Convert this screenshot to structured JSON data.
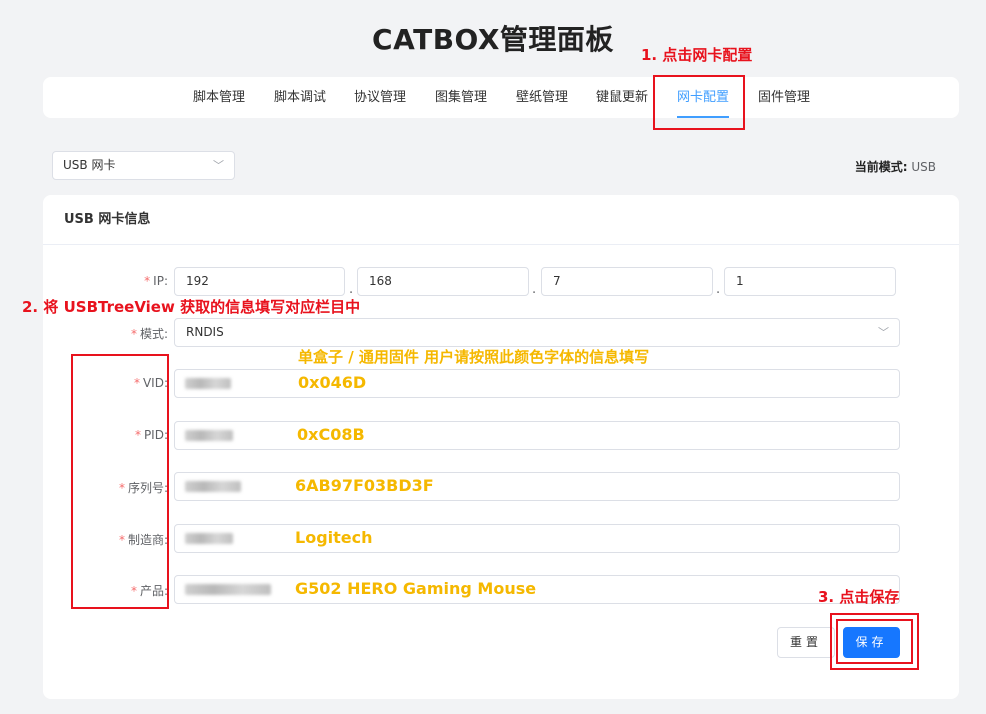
{
  "page": {
    "title": "CATBOX管理面板"
  },
  "nav": {
    "items": [
      {
        "label": "脚本管理"
      },
      {
        "label": "脚本调试"
      },
      {
        "label": "协议管理"
      },
      {
        "label": "图集管理"
      },
      {
        "label": "壁纸管理"
      },
      {
        "label": "键鼠更新"
      },
      {
        "label": "网卡配置",
        "active": true
      },
      {
        "label": "固件管理"
      }
    ]
  },
  "device_select": {
    "value": "USB 网卡"
  },
  "mode_status": {
    "label": "当前模式:",
    "value": "USB"
  },
  "card": {
    "title": "USB 网卡信息"
  },
  "form": {
    "required_mark": "*",
    "ip": {
      "label": "IP:",
      "octets": [
        "192",
        "168",
        "7",
        "1"
      ],
      "separator": "."
    },
    "mode": {
      "label": "模式:",
      "value": "RNDIS"
    },
    "vid": {
      "label": "VID:"
    },
    "pid": {
      "label": "PID:"
    },
    "serial": {
      "label": "序列号:"
    },
    "manufacturer": {
      "label": "制造商:"
    },
    "product": {
      "label": "产品:"
    }
  },
  "hints": {
    "header": "单盒子 / 通用固件 用户请按照此颜色字体的信息填写",
    "vid": "0x046D",
    "pid": "0xC08B",
    "serial": "6AB97F03BD3F",
    "manufacturer": "Logitech",
    "product": "G502 HERO Gaming Mouse"
  },
  "annotations": {
    "step1": "1. 点击网卡配置",
    "step2": "2. 将 USBTreeView 获取的信息填写对应栏目中",
    "step3": "3. 点击保存"
  },
  "buttons": {
    "reset": "重置",
    "save": "保存"
  },
  "colors": {
    "accent": "#409eff",
    "save_button": "#1677ff",
    "annotation_red": "#e8121d",
    "hint_yellow": "#f5b800",
    "required": "#f56c6c"
  },
  "icons": {
    "chevron": "chevron-down-icon"
  }
}
